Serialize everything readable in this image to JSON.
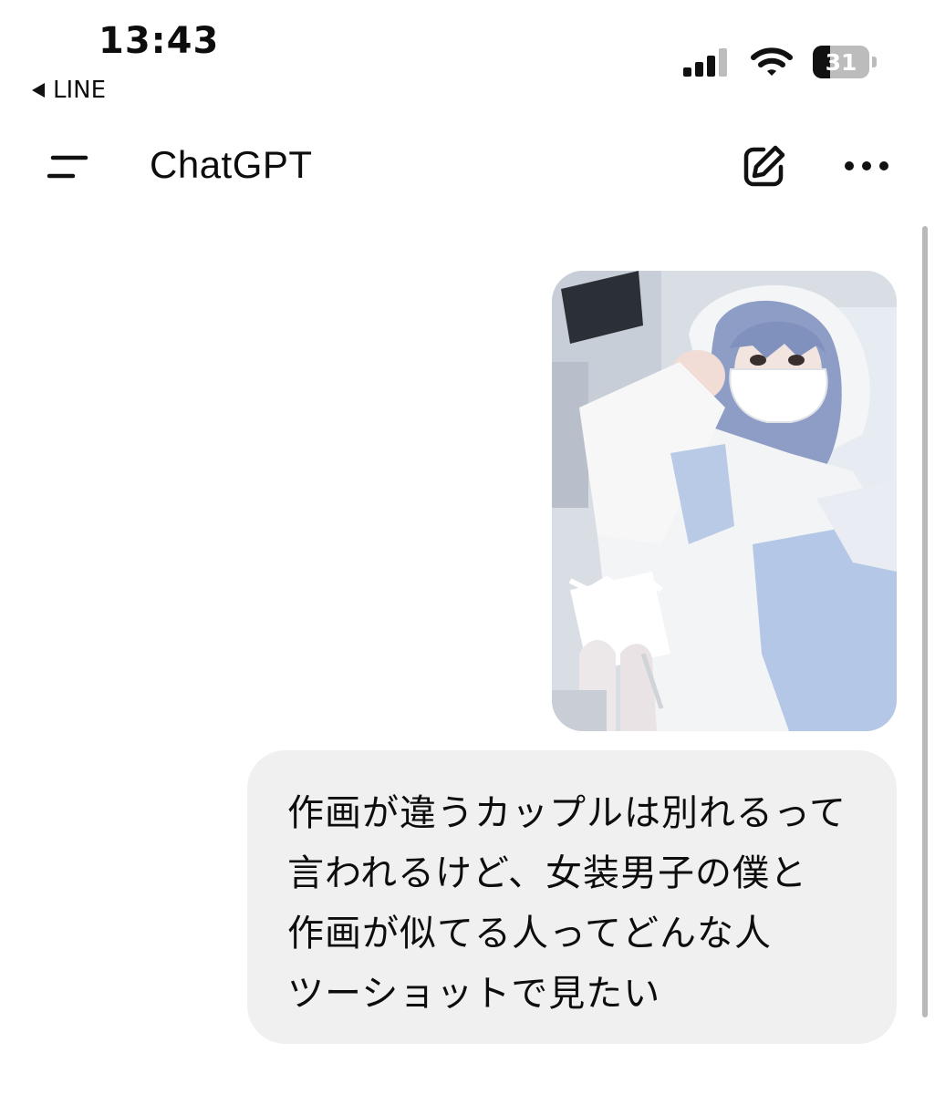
{
  "status_bar": {
    "time": "13:43",
    "back_app": "LINE",
    "battery_level": "31",
    "battery_fraction": 0.31
  },
  "header": {
    "title": "ChatGPT",
    "menu_icon": "hamburger-menu-icon",
    "new_chat_icon": "edit-pencil-icon",
    "more_icon": "ellipsis-icon"
  },
  "conversation": {
    "user_message": {
      "image_alt_subject": "photo",
      "lines": [
        "作画が違うカップルは別れるって",
        "言われるけど、女装男子の僕と",
        "作画が似てる人ってどんな人",
        "ツーショットで見たい"
      ]
    }
  },
  "colors": {
    "bubble_bg": "#f0f0f0",
    "text": "#0d0d0d",
    "background": "#ffffff"
  }
}
